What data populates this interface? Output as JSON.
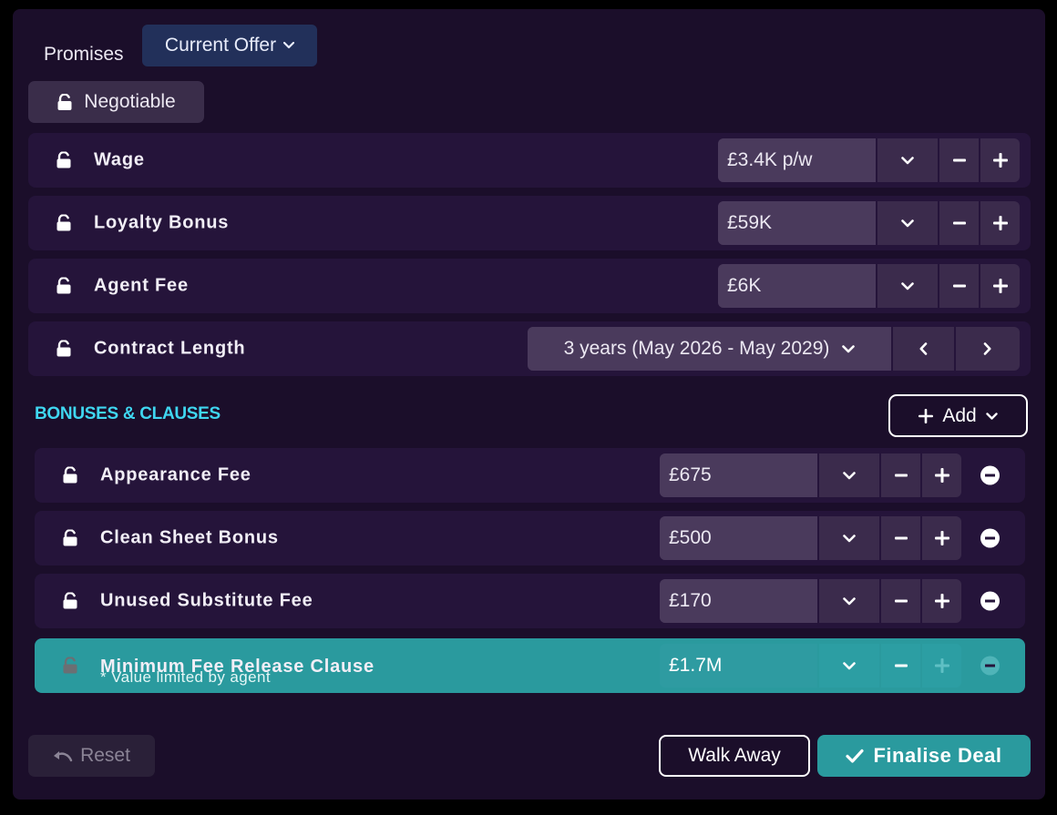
{
  "header": {
    "promises_label": "Promises",
    "offer_dropdown_label": "Current Offer",
    "negotiable_label": "Negotiable"
  },
  "terms": [
    {
      "label": "Wage",
      "value": "£3.4K p/w"
    },
    {
      "label": "Loyalty Bonus",
      "value": "£59K"
    },
    {
      "label": "Agent Fee",
      "value": "£6K"
    },
    {
      "label": "Contract Length",
      "value": "3 years (May 2026 - May 2029)"
    }
  ],
  "bonuses": {
    "title": "BONUSES & CLAUSES",
    "add_label": "Add",
    "items": [
      {
        "label": "Appearance Fee",
        "value": "£675"
      },
      {
        "label": "Clean Sheet Bonus",
        "value": "£500"
      },
      {
        "label": "Unused Substitute Fee",
        "value": "£170"
      },
      {
        "label": "Minimum Fee Release Clause",
        "value": "£1.7M",
        "note": "* Value limited by agent"
      }
    ]
  },
  "footer": {
    "reset_label": "Reset",
    "walk_away_label": "Walk Away",
    "finalise_label": "Finalise Deal"
  },
  "colors": {
    "panel_bg": "#1b0e2a",
    "row_bg": "#25143a",
    "accent_teal": "#2a9a9e",
    "section_title": "#3fd6f0",
    "offer_button": "#22305a"
  }
}
